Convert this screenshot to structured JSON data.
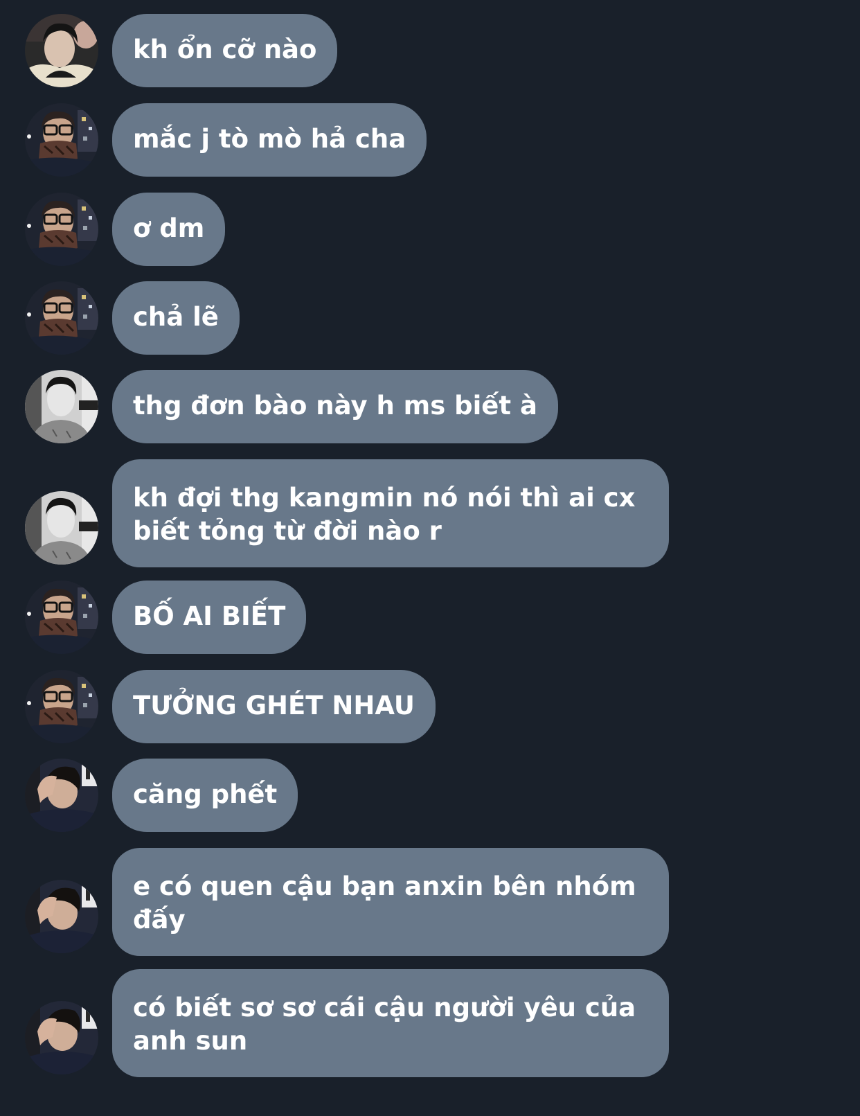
{
  "chat": {
    "messages": [
      {
        "sender": "user-a",
        "text": "kh ổn cỡ nào"
      },
      {
        "sender": "user-b",
        "text": "mắc j tò mò hả cha"
      },
      {
        "sender": "user-b",
        "text": "ơ dm"
      },
      {
        "sender": "user-b",
        "text": "chả lẽ"
      },
      {
        "sender": "user-c",
        "text": "thg đơn bào này h ms biết à"
      },
      {
        "sender": "user-c",
        "lines": [
          "kh đợi thg kangmin nó nói thì ai cx",
          "biết tỏng từ đời nào r"
        ]
      },
      {
        "sender": "user-b",
        "text": "BỐ AI BIẾT"
      },
      {
        "sender": "user-b",
        "text": "TƯỞNG GHÉT NHAU"
      },
      {
        "sender": "user-d",
        "text": "căng phết"
      },
      {
        "sender": "user-d",
        "lines": [
          "e có quen cậu bạn anxin bên nhóm",
          "đấy"
        ]
      },
      {
        "sender": "user-d",
        "lines": [
          "có biết sơ sơ cái cậu người yêu của",
          "anh sun"
        ]
      }
    ]
  },
  "colors": {
    "background": "#19202a",
    "bubble": "#68788a",
    "text": "#ffffff"
  }
}
